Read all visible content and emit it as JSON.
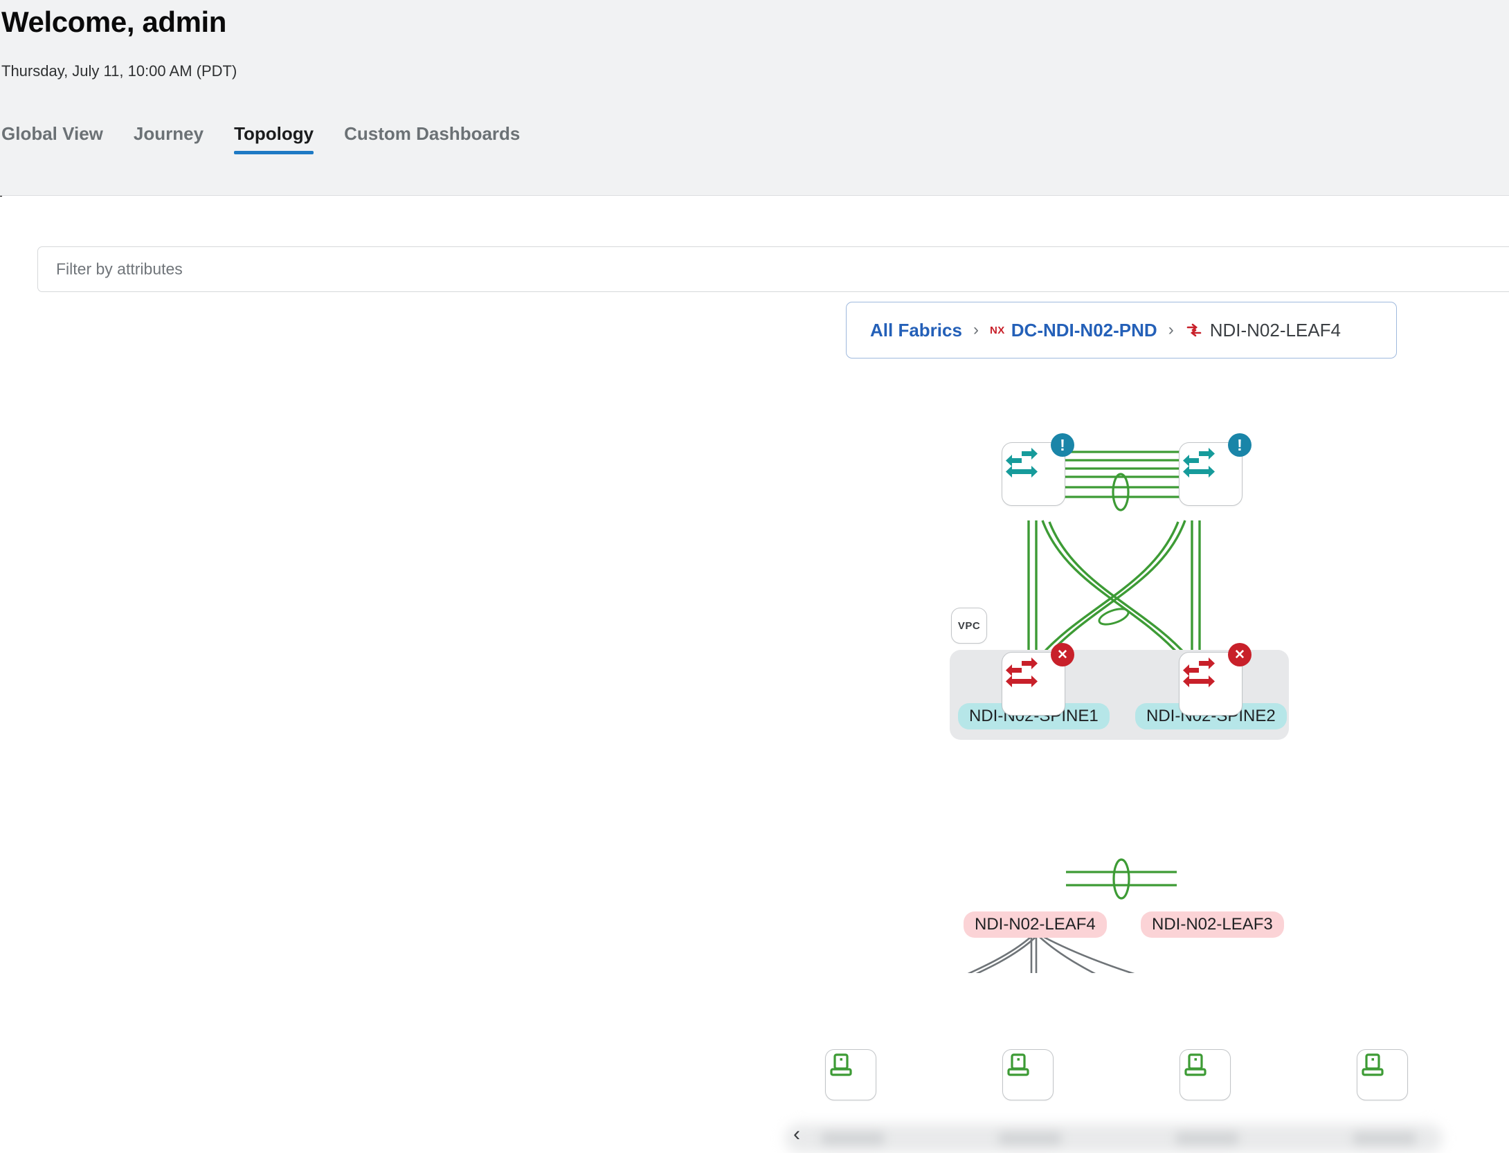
{
  "header": {
    "welcome_title": "Welcome, admin",
    "date_line": "Thursday, July 11, 10:00 AM (PDT)",
    "tabs": [
      {
        "label": "Global View",
        "active": false
      },
      {
        "label": "Journey",
        "active": false
      },
      {
        "label": "Topology",
        "active": true
      },
      {
        "label": "Custom Dashboards",
        "active": false
      }
    ],
    "active_tab_underline_color": "#1e7ac4"
  },
  "filter": {
    "placeholder": "Filter by attributes",
    "value": ""
  },
  "breadcrumb": {
    "root_label": "All Fabrics",
    "separator": "›",
    "fabric_tag": "NX",
    "fabric_label": "DC-NDI-N02-PND",
    "current_label": "NDI-N02-LEAF4"
  },
  "topology": {
    "spines": [
      {
        "name": "NDI-N02-SPINE1",
        "status": "warning",
        "badge_glyph": "!",
        "icon": "router-icon",
        "icon_color": "#169b9b"
      },
      {
        "name": "NDI-N02-SPINE2",
        "status": "warning",
        "badge_glyph": "!",
        "icon": "router-icon",
        "icon_color": "#169b9b"
      }
    ],
    "leaves": [
      {
        "name": "NDI-N02-LEAF4",
        "status": "error",
        "badge_glyph": "✕",
        "icon": "router-icon",
        "icon_color": "#c8202a"
      },
      {
        "name": "NDI-N02-LEAF3",
        "status": "error",
        "badge_glyph": "✕",
        "icon": "router-icon",
        "icon_color": "#c8202a"
      }
    ],
    "vpc_group_label": "VPC",
    "hosts": [
      {
        "icon": "laptop-icon",
        "label": ""
      },
      {
        "icon": "laptop-icon",
        "label": ""
      },
      {
        "icon": "laptop-icon",
        "label": ""
      },
      {
        "icon": "laptop-icon",
        "label": ""
      }
    ],
    "links": {
      "spine_to_spine_count": 6,
      "leaf_to_leaf_count": 2,
      "spine_to_leaf_color": "#3d9b35",
      "leaf_to_host_color": "#6f7478"
    },
    "colors": {
      "spine_label_bg": "#b6e6e8",
      "leaf_label_bg": "#fbd3d6",
      "warning_badge": "#1a85a8",
      "error_badge": "#c8202a",
      "link_green": "#3d9b35",
      "vpc_group_bg": "#e7e8ea"
    }
  }
}
